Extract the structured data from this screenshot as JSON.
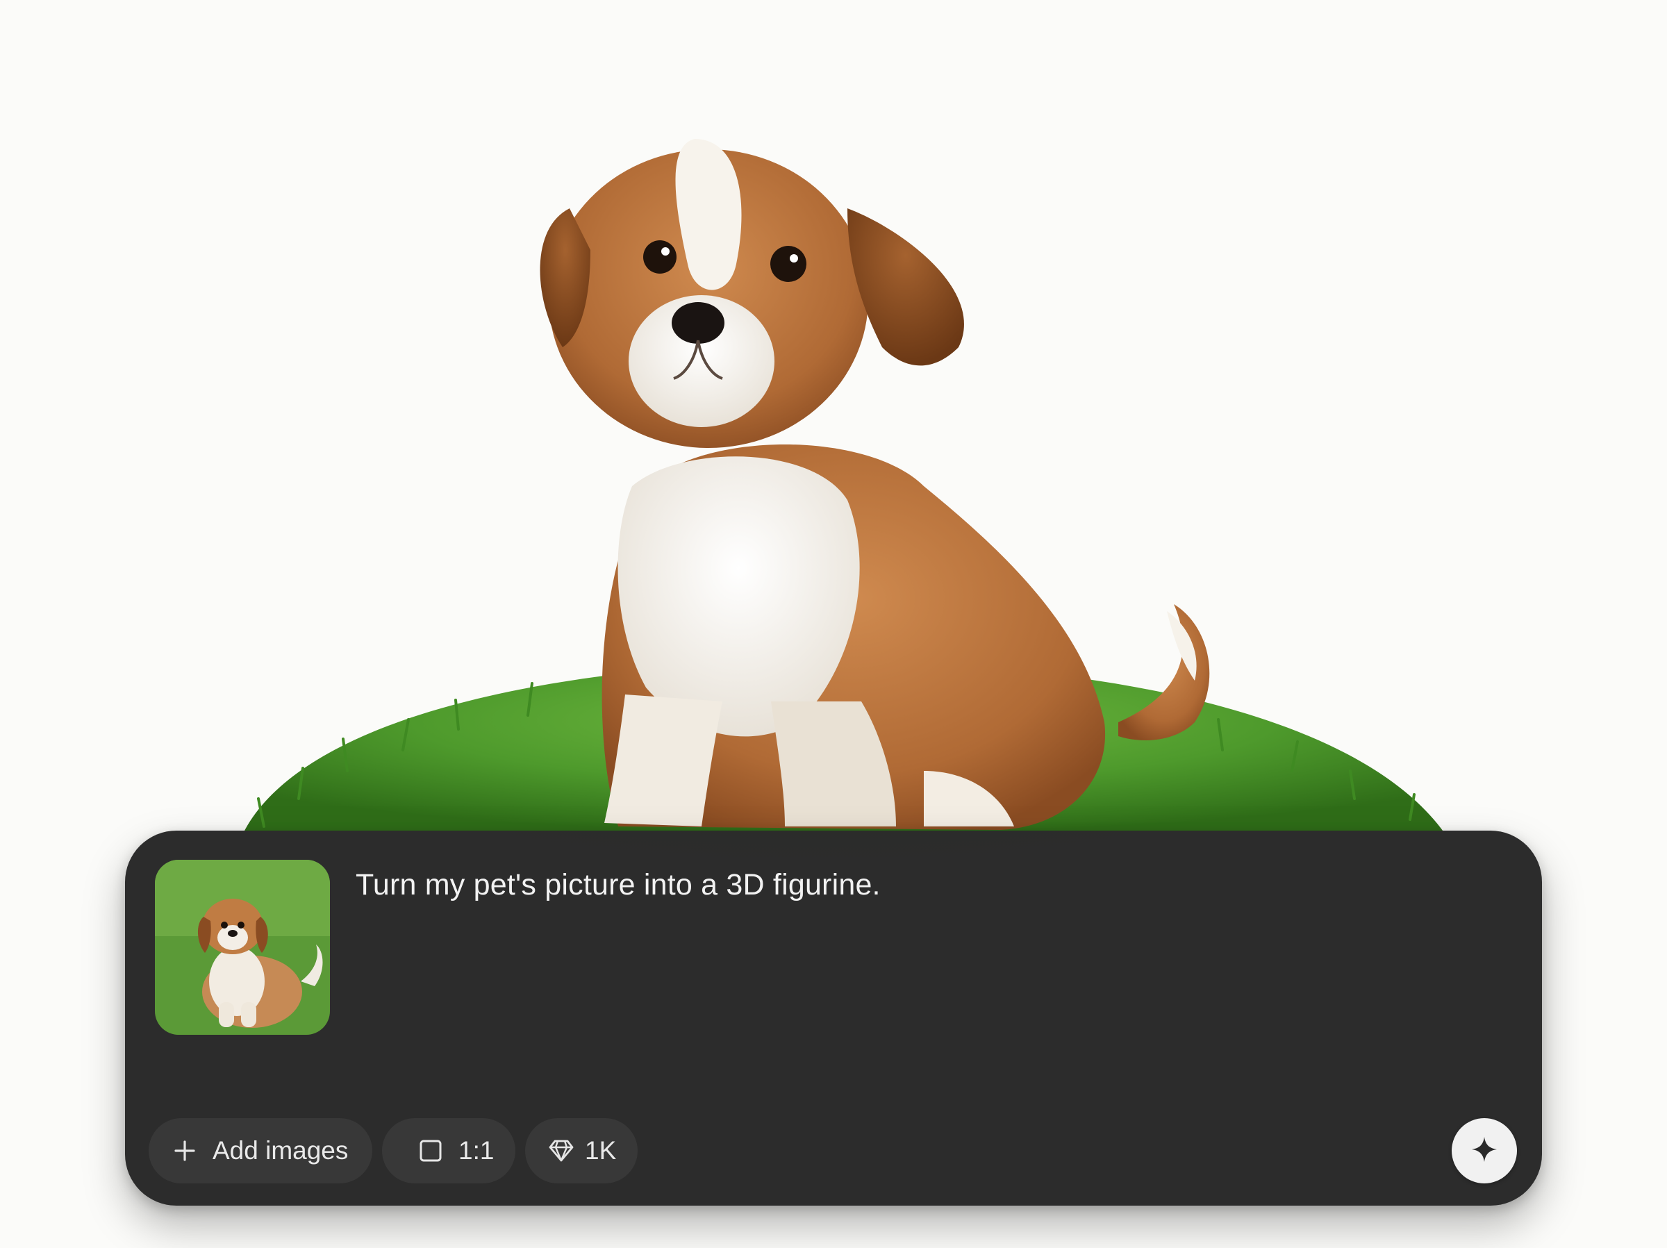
{
  "hero": {
    "subject_icon": "puppy-on-grass-illustration"
  },
  "prompt": {
    "thumbnail_icon": "pet-photo-thumbnail",
    "text": "Turn my pet's picture into a 3D figurine."
  },
  "toolbar": {
    "add_images": {
      "icon": "plus-icon",
      "label": "Add images"
    },
    "aspect_ratio": {
      "icon": "square-icon",
      "label": "1:1"
    },
    "resolution": {
      "icon": "diamond-icon",
      "label": "1K"
    }
  },
  "generate": {
    "icon": "sparkle-icon"
  },
  "colors": {
    "background": "#fbfbf9",
    "panel": "#2c2c2c",
    "chip": "#383838",
    "text": "#f2f2f2",
    "button": "#f1f1f1",
    "grass": "#4e9a2c",
    "fur": "#b06a35"
  }
}
